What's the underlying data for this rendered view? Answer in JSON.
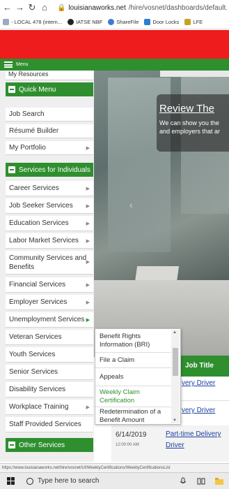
{
  "browser": {
    "url_host": "louisianaworks.net",
    "url_path": "/hire/vosnet/dashboards/default.",
    "bookmarks": [
      {
        "label": "- LOCAL 478 (intern...",
        "color": "#9aa9c4"
      },
      {
        "label": "IATSE NBF",
        "color": "#222222"
      },
      {
        "label": "ShareFile",
        "color": "#3a7bd5"
      },
      {
        "label": "Door Locks",
        "color": "#2a7fd3"
      },
      {
        "label": "LFE",
        "color": "#c8a21c"
      }
    ]
  },
  "menu_bar": {
    "label": "Menu"
  },
  "sidebar": {
    "top_cut_item": "My Resources",
    "quick_menu": {
      "title": "Quick Menu",
      "items": [
        "Job Search",
        "Résumé Builder",
        "My Portfolio"
      ]
    },
    "services_individuals": {
      "title": "Services for Individuals",
      "items": [
        "Career Services",
        "Job Seeker Services",
        "Education Services",
        "Labor Market Services",
        "Community Services and Benefits",
        "Financial Services",
        "Employer Services",
        "Unemployment Services",
        "Veteran Services",
        "Youth Services",
        "Senior Services",
        "Disability Services",
        "Workplace Training",
        "Staff Provided Services"
      ]
    },
    "other_services": {
      "title": "Other Services"
    }
  },
  "flyout": {
    "items": [
      "Benefit Rights Information (BRI)",
      "File a Claim",
      "Appeals",
      "Weekly Claim Certification",
      "Redetermination of a Benefit Amount"
    ]
  },
  "hero": {
    "title": "Review The",
    "subtitle_line1": "We can show you the",
    "subtitle_line2": "and employers that ar"
  },
  "table": {
    "header_job_title": "Job Title",
    "rows": [
      {
        "job": "very Driver"
      },
      {
        "job": "very Driver"
      },
      {
        "date": "6/14/2019",
        "time": "12:00:00 AM",
        "job_line1": "Part-time Delivery",
        "job_line2": "Driver"
      }
    ]
  },
  "status_url": "https://www.louisianaworks.net/hire/vosnet/UI/WeeklyCertifications/WeeklyCertificationsList",
  "taskbar": {
    "search_placeholder": "Type here to search"
  },
  "colors": {
    "green": "#2f8f2f",
    "red": "#ee1c1c",
    "link": "#1a3fa0"
  }
}
